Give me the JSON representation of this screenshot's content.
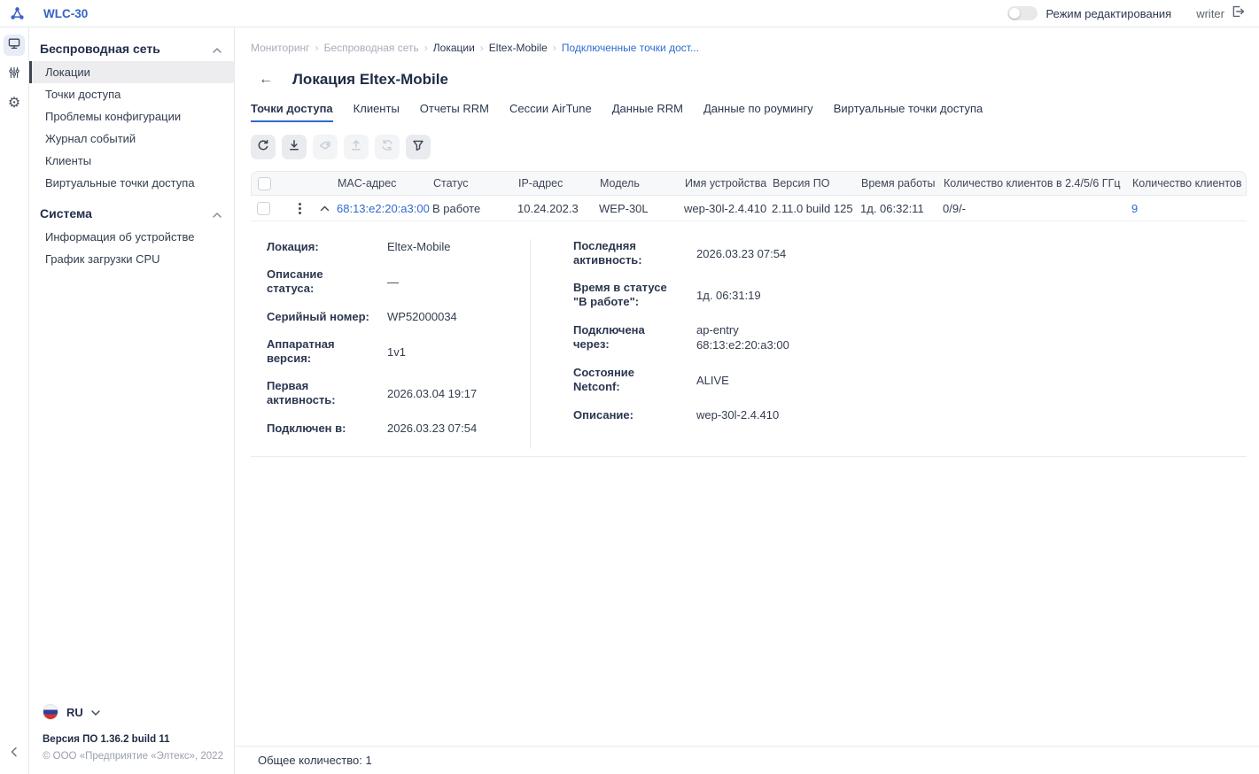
{
  "colors": {
    "accent": "#3761c9",
    "link": "#2f6bd2",
    "dark_text": "#1f2c48",
    "muted_text": "#a8aeba"
  },
  "topbar": {
    "app_title": "WLC-30",
    "logo_icon": "eltex-logo-icon",
    "edit_mode_label": "Режим редактирования",
    "edit_mode_on": false,
    "username": "writer",
    "logout_icon": "logout-icon"
  },
  "rail": {
    "items": [
      {
        "icon": "monitor-icon",
        "selected": true
      },
      {
        "icon": "sliders-icon",
        "selected": false
      },
      {
        "icon": "gear-icon",
        "selected": false,
        "glyph": "⚙"
      }
    ],
    "collapse_icon": "chevron-left-icon"
  },
  "sidebar": {
    "sections": [
      {
        "label": "Беспроводная сеть",
        "collapse_icon": "chevron-up-icon",
        "items": [
          {
            "label": "Локации",
            "selected": true
          },
          {
            "label": "Точки доступа"
          },
          {
            "label": "Проблемы конфигурации"
          },
          {
            "label": "Журнал событий"
          },
          {
            "label": "Клиенты"
          },
          {
            "label": "Виртуальные точки доступа"
          }
        ]
      },
      {
        "label": "Система",
        "collapse_icon": "chevron-up-icon",
        "items": [
          {
            "label": "Информация об устройстве"
          },
          {
            "label": "График загрузки CPU"
          }
        ]
      }
    ],
    "language": {
      "code": "RU",
      "flag_icon": "ru-flag-icon"
    },
    "version": "Версия ПО 1.36.2 build 11",
    "copyright": "© ООО «Предприятие «Элтекс», 2022"
  },
  "breadcrumb": {
    "separator": "›",
    "items": [
      {
        "label": "Мониторинг",
        "style": "muted"
      },
      {
        "label": "Беспроводная сеть",
        "style": "muted"
      },
      {
        "label": "Локации",
        "style": "dark"
      },
      {
        "label": "Eltex-Mobile",
        "style": "dark"
      },
      {
        "label": "Подключенные точки дост...",
        "style": "link"
      }
    ]
  },
  "page": {
    "title": "Локация Eltex-Mobile",
    "back_icon": "back-arrow-icon",
    "back_glyph": "←"
  },
  "tabs": [
    {
      "label": "Точки доступа",
      "active": true
    },
    {
      "label": "Клиенты"
    },
    {
      "label": "Отчеты RRM"
    },
    {
      "label": "Сессии AirTune"
    },
    {
      "label": "Данные RRM"
    },
    {
      "label": "Данные по роумингу"
    },
    {
      "label": "Виртуальные точки доступа"
    }
  ],
  "toolbar": {
    "buttons": [
      {
        "icon": "refresh-icon",
        "enabled": true
      },
      {
        "icon": "download-icon",
        "enabled": true
      },
      {
        "icon": "tag-icon",
        "enabled": false
      },
      {
        "icon": "upload-icon",
        "enabled": false
      },
      {
        "icon": "sync-icon",
        "enabled": false
      },
      {
        "icon": "filter-icon",
        "enabled": true
      }
    ]
  },
  "table": {
    "columns": [
      "MAC-адрес",
      "Статус",
      "IP-адрес",
      "Модель",
      "Имя устройства",
      "Версия ПО",
      "Время работы",
      "Количество клиентов в 2.4/5/6 ГГц",
      "Количество клиентов"
    ],
    "rows": [
      {
        "mac": "68:13:e2:20:a3:00",
        "status": "В работе",
        "ip": "10.24.202.3",
        "model": "WEP-30L",
        "device_name": "wep-30l-2.4.410",
        "firmware": "2.11.0 build 125",
        "uptime": "1д. 06:32:11",
        "clients_by_band": "0/9/-",
        "clients_total": "9",
        "expanded": true
      }
    ]
  },
  "details": {
    "left": [
      {
        "label": "Локация:",
        "value": "Eltex-Mobile"
      },
      {
        "label": "Описание статуса:",
        "value": "—"
      },
      {
        "label": "Серийный номер:",
        "value": "WP52000034"
      },
      {
        "label": "Аппаратная\nверсия:",
        "value": "1v1"
      },
      {
        "label": "Первая\nактивность:",
        "value": "2026.03.04 19:17"
      },
      {
        "label": "Подключен в:",
        "value": "2026.03.23 07:54"
      }
    ],
    "right": [
      {
        "label": "Последняя\nактивность:",
        "value": "2026.03.23 07:54"
      },
      {
        "label": "Время в статусе\n\"В работе\":",
        "value": "1д. 06:31:19"
      },
      {
        "label": "Подключена через:",
        "value": "ap-entry\n68:13:e2:20:a3:00"
      },
      {
        "label": "Состояние Netconf:",
        "value": "ALIVE"
      },
      {
        "label": "Описание:",
        "value": "wep-30l-2.4.410"
      }
    ]
  },
  "footer": {
    "total_label": "Общее количество: 1"
  }
}
